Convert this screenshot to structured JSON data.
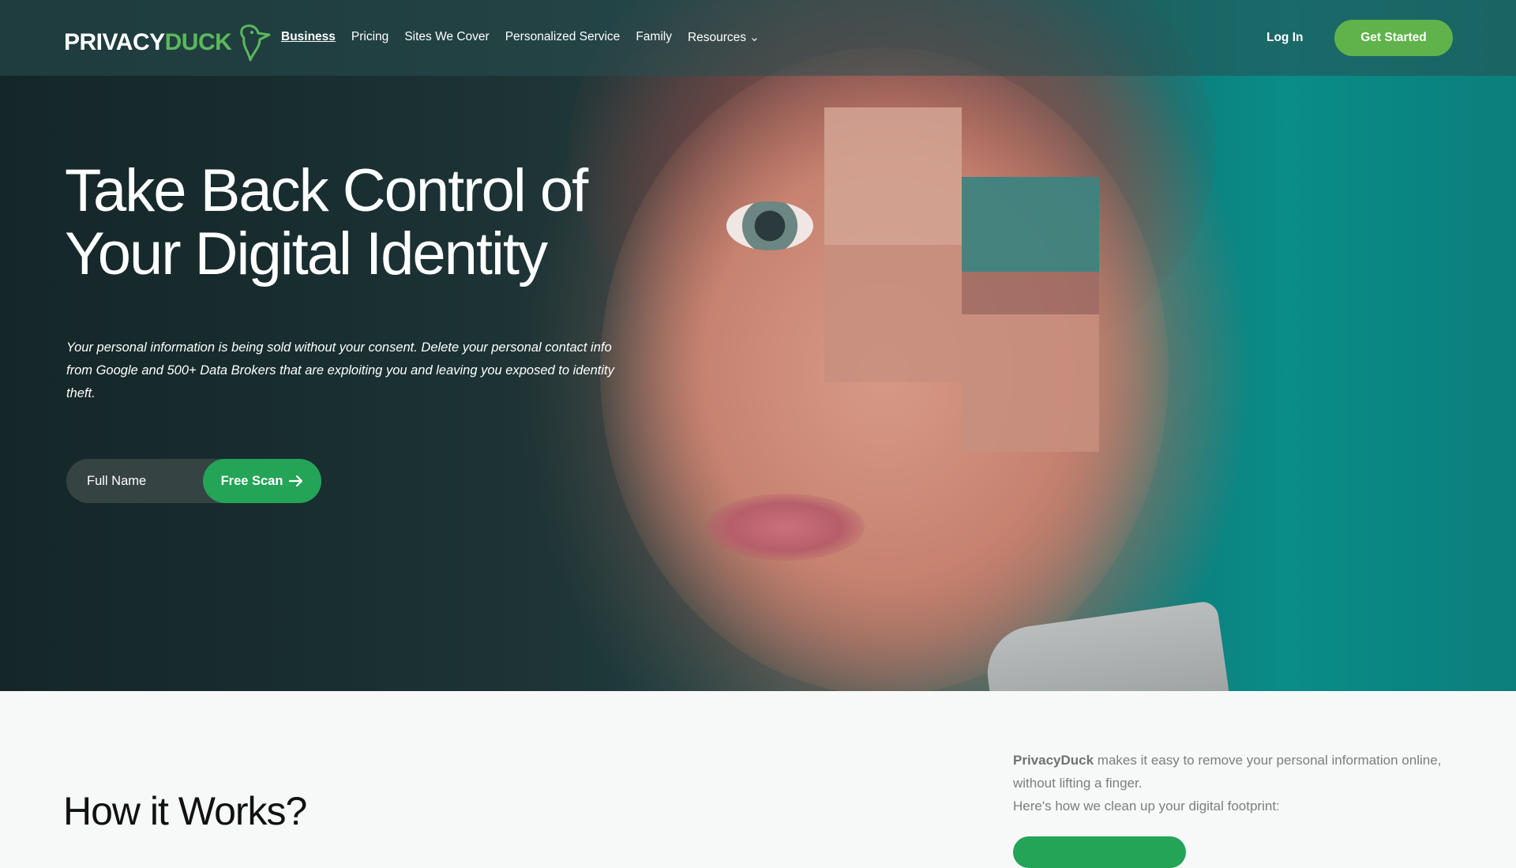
{
  "brand": {
    "logo_part1": "PRIVACY",
    "logo_part2": "DUCK"
  },
  "nav": {
    "links": [
      {
        "label": "Business",
        "active": true
      },
      {
        "label": "Pricing"
      },
      {
        "label": "Sites We Cover"
      },
      {
        "label": "Personalized Service"
      },
      {
        "label": "Family"
      },
      {
        "label": "Resources",
        "has_dropdown": true
      }
    ],
    "login_label": "Log In",
    "cta_label": "Get Started"
  },
  "hero": {
    "headline_line1": "Take Back Control of",
    "headline_line2": "Your Digital Identity",
    "subtext": "Your personal information is being sold without your consent. Delete your personal contact info from Google and 500+ Data Brokers that are exploiting you and leaving you exposed to identity theft.",
    "input_placeholder": "Full Name",
    "scan_button_label": "Free Scan"
  },
  "how_it_works": {
    "title": "How it Works?",
    "intro_brand": "PrivacyDuck",
    "intro_text": " makes it easy to remove your personal information online, without lifting a finger.",
    "intro_line2": "Here's how we clean up your digital footprint:"
  },
  "colors": {
    "brand_green": "#5fb34a",
    "scan_green": "#23a457",
    "teal_background": "#0a8c88"
  }
}
